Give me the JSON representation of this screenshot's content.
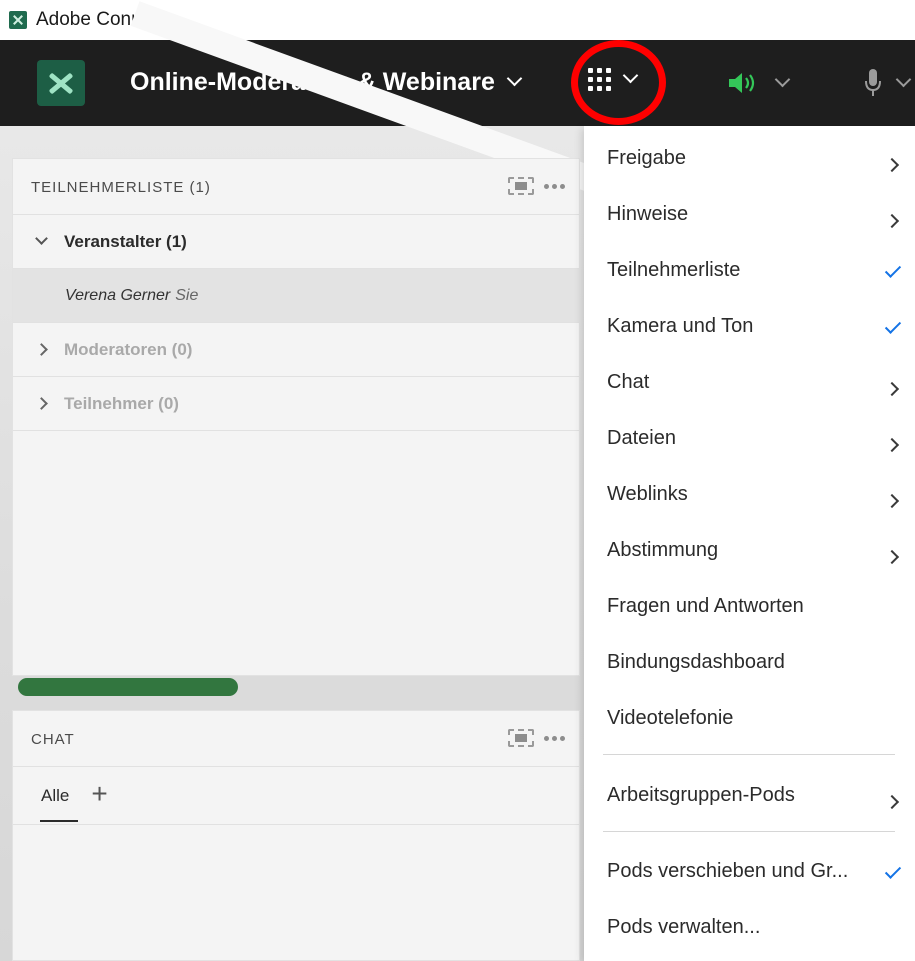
{
  "window": {
    "title": "Adobe Connect"
  },
  "header": {
    "meeting_title": "Online-Moderation & Webinare"
  },
  "participants_pod": {
    "title": "TEILNEHMERLISTE  (1)",
    "host_group": "Veranstalter (1)",
    "attendee_name": "Verena Gerner",
    "attendee_you": "Sie",
    "presenters_group": "Moderatoren (0)",
    "participants_group": "Teilnehmer (0)"
  },
  "chat_pod": {
    "title": "CHAT",
    "tab_all": "Alle",
    "add_tab": "+"
  },
  "menu": {
    "items": [
      {
        "label": "Freigabe",
        "suffix": "submenu"
      },
      {
        "label": "Hinweise",
        "suffix": "submenu"
      },
      {
        "label": "Teilnehmerliste",
        "suffix": "check"
      },
      {
        "label": "Kamera und Ton",
        "suffix": "check"
      },
      {
        "label": "Chat",
        "suffix": "submenu"
      },
      {
        "label": "Dateien",
        "suffix": "submenu"
      },
      {
        "label": "Weblinks",
        "suffix": "submenu"
      },
      {
        "label": "Abstimmung",
        "suffix": "submenu"
      },
      {
        "label": "Fragen und Antworten",
        "suffix": "none"
      },
      {
        "label": "Bindungsdashboard",
        "suffix": "none"
      },
      {
        "label": "Videotelefonie",
        "suffix": "none"
      },
      {
        "label": "Arbeitsgruppen-Pods",
        "suffix": "submenu"
      },
      {
        "label": "Pods verschieben und Gr...",
        "suffix": "check"
      },
      {
        "label": "Pods verwalten..."
      }
    ]
  },
  "colors": {
    "header_bg": "#1e1e1e",
    "accent_check": "#1473e6",
    "highlight_circle": "#ff0000"
  },
  "icons": [
    "adobe-connect-icon",
    "grid-apps-icon",
    "speaker-icon",
    "microphone-icon",
    "fullscreen-icon",
    "more-icon"
  ]
}
